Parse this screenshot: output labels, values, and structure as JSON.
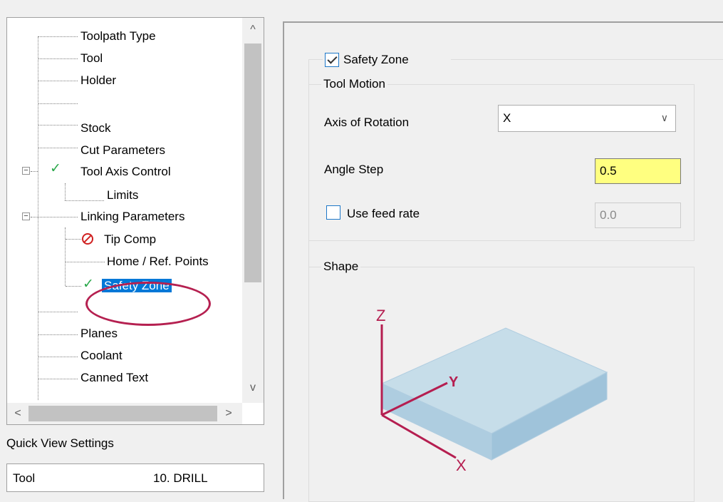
{
  "tree": {
    "items": [
      {
        "label": "Toolpath Type"
      },
      {
        "label": "Tool"
      },
      {
        "label": "Holder"
      },
      {
        "label": ""
      },
      {
        "label": "Stock"
      },
      {
        "label": "Cut Parameters"
      },
      {
        "label": "Tool Axis Control",
        "status": "check"
      },
      {
        "label": "Limits"
      },
      {
        "label": "Linking Parameters"
      },
      {
        "label": "Tip Comp",
        "status": "error"
      },
      {
        "label": "Home / Ref. Points"
      },
      {
        "label": "Safety Zone",
        "status": "check",
        "selected": true
      },
      {
        "label": ""
      },
      {
        "label": "Planes"
      },
      {
        "label": "Coolant"
      },
      {
        "label": "Canned Text"
      }
    ],
    "scroll_up": "^",
    "scroll_down": "v",
    "scroll_left": "<",
    "scroll_right": ">"
  },
  "quick_view": {
    "title": "Quick View Settings",
    "rows": [
      {
        "key": "Tool",
        "value": "10. DRILL"
      }
    ]
  },
  "safety_zone": {
    "enabled": true,
    "label": "Safety Zone",
    "tool_motion": {
      "title": "Tool Motion",
      "axis_label": "Axis of Rotation",
      "axis_value": "X",
      "angle_label": "Angle Step",
      "angle_value": "0.5",
      "feed_label": "Use feed rate",
      "feed_checked": false,
      "feed_value": "0.0"
    },
    "shape": {
      "title": "Shape",
      "axis_x": "X",
      "axis_y": "Y",
      "axis_z": "Z"
    }
  },
  "colors": {
    "selection": "#0078d7",
    "highlight_field": "#ffff80",
    "annotation": "#b52050",
    "axis": "#b51e50",
    "box_top": "#c6dde9",
    "box_side": "#a9c8dc"
  }
}
